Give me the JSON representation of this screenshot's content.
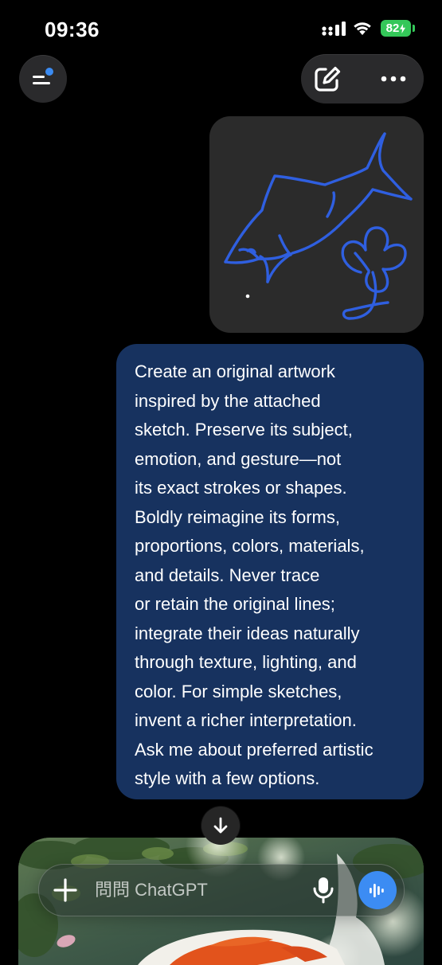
{
  "status_bar": {
    "time": "09:36",
    "battery": "82"
  },
  "top_nav": {
    "menu_icon": "sidebar-menu-icon",
    "notification_dot_color": "#3b8bf2",
    "compose_icon": "compose-icon",
    "more_icon": "more-horizontal-icon"
  },
  "conversation": {
    "sketch": {
      "stroke_color": "#2f5fe0"
    },
    "prompt": "Create an original artwork\ninspired by the attached\nsketch. Preserve its subject,\nemotion, and gesture—not\nits exact strokes or shapes.\nBoldly reimagine its forms,\nproportions, colors, materials,\nand details. Never trace\nor retain the original lines;\nintegrate their ideas naturally\nthrough texture, lighting, and\ncolor. For simple sketches,\ninvent a richer interpretation.\nAsk me about preferred artistic\nstyle with a few options.",
    "bubble_color": "#17325f"
  },
  "scroll_down_icon": "arrow-down-icon",
  "composer": {
    "placeholder": "問問 ChatGPT",
    "plus_icon": "plus-icon",
    "mic_icon": "microphone-icon",
    "voice_icon": "voice-waveform-icon",
    "voice_button_color": "#3c8cf3"
  }
}
